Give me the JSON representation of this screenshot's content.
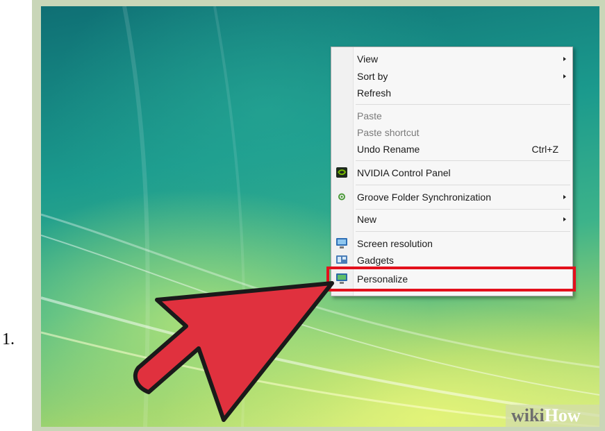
{
  "list_marker": "1.",
  "menu": {
    "items": [
      {
        "label": "View",
        "submenu": true
      },
      {
        "label": "Sort by",
        "submenu": true
      },
      {
        "label": "Refresh"
      },
      {
        "label": "Paste",
        "disabled": true
      },
      {
        "label": "Paste shortcut",
        "disabled": true
      },
      {
        "label": "Undo Rename",
        "shortcut": "Ctrl+Z"
      },
      {
        "label": "NVIDIA Control Panel",
        "icon": "nvidia-icon"
      },
      {
        "label": "Groove Folder Synchronization",
        "icon": "groove-icon",
        "submenu": true
      },
      {
        "label": "New",
        "submenu": true
      },
      {
        "label": "Screen resolution",
        "icon": "monitor-icon"
      },
      {
        "label": "Gadgets",
        "icon": "gadgets-icon"
      },
      {
        "label": "Personalize",
        "icon": "personalize-icon"
      }
    ]
  },
  "annotation": {
    "highlighted_item": "Personalize",
    "highlight_color": "#e3101c",
    "pointer_color": "#e0313e"
  },
  "watermark": {
    "part1": "wiki",
    "part2": "How"
  }
}
